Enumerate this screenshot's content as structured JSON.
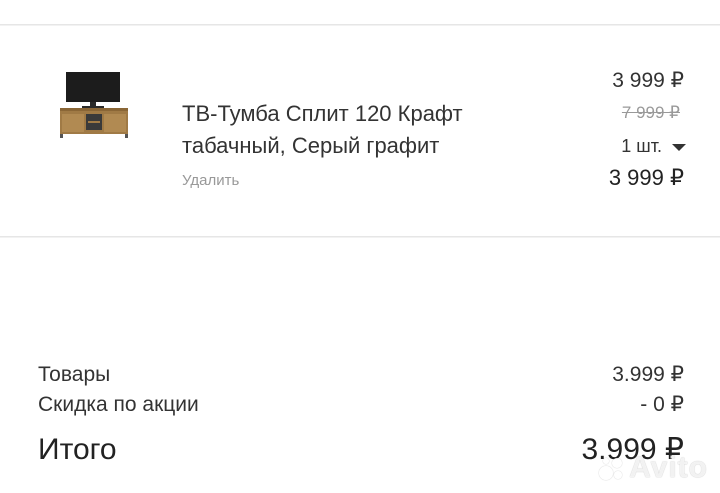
{
  "cart": {
    "item": {
      "title": "ТВ-Тумба Сплит 120 Крафт табачный, Серый графит",
      "remove_label": "Удалить",
      "price_current": "3 999 ₽",
      "price_old": "7 999 ₽",
      "quantity": "1 шт.",
      "line_total": "3 999 ₽",
      "image_icon": "tv-stand-product-image"
    }
  },
  "summary": {
    "goods_label": "Товары",
    "goods_value": "3.999 ₽",
    "discount_label": "Скидка по акции",
    "discount_value": "- 0 ₽",
    "total_label": "Итого",
    "total_value": "3.999 ₽"
  },
  "watermark": {
    "text": "Avito"
  },
  "colors": {
    "background": "#f2f2f2",
    "card": "#ffffff",
    "muted_text": "#999999"
  }
}
